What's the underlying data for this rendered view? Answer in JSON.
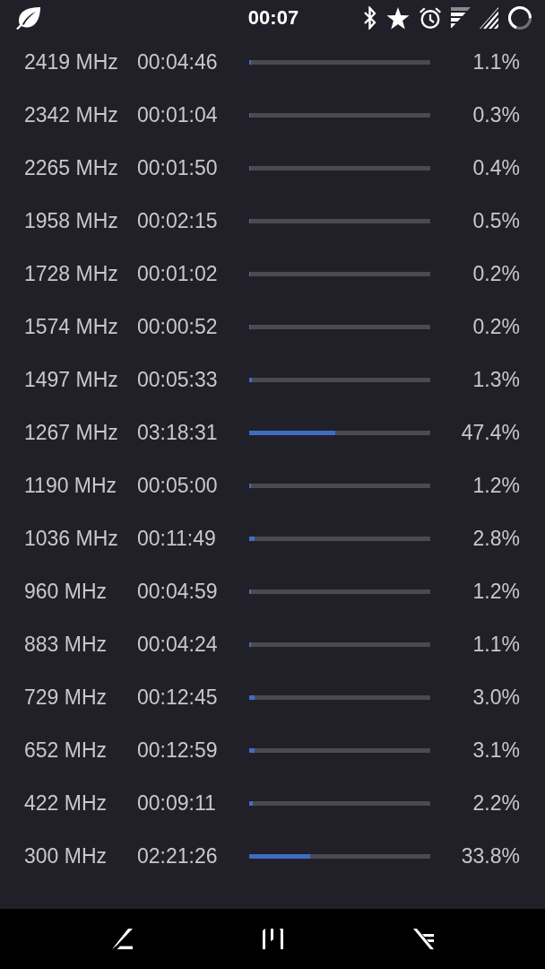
{
  "status_bar": {
    "time": "00:07"
  },
  "rows": [
    {
      "frequency": "2419 MHz",
      "time": "00:04:46",
      "level": 0.011,
      "percent": "1.1%"
    },
    {
      "frequency": "2342 MHz",
      "time": "00:01:04",
      "level": 0.003,
      "percent": "0.3%"
    },
    {
      "frequency": "2265 MHz",
      "time": "00:01:50",
      "level": 0.004,
      "percent": "0.4%"
    },
    {
      "frequency": "1958 MHz",
      "time": "00:02:15",
      "level": 0.005,
      "percent": "0.5%"
    },
    {
      "frequency": "1728 MHz",
      "time": "00:01:02",
      "level": 0.002,
      "percent": "0.2%"
    },
    {
      "frequency": "1574 MHz",
      "time": "00:00:52",
      "level": 0.002,
      "percent": "0.2%"
    },
    {
      "frequency": "1497 MHz",
      "time": "00:05:33",
      "level": 0.013,
      "percent": "1.3%"
    },
    {
      "frequency": "1267 MHz",
      "time": "03:18:31",
      "level": 0.474,
      "percent": "47.4%"
    },
    {
      "frequency": "1190 MHz",
      "time": "00:05:00",
      "level": 0.012,
      "percent": "1.2%"
    },
    {
      "frequency": "1036 MHz",
      "time": "00:11:49",
      "level": 0.028,
      "percent": "2.8%"
    },
    {
      "frequency": "960 MHz",
      "time": "00:04:59",
      "level": 0.012,
      "percent": "1.2%"
    },
    {
      "frequency": "883 MHz",
      "time": "00:04:24",
      "level": 0.011,
      "percent": "1.1%"
    },
    {
      "frequency": "729 MHz",
      "time": "00:12:45",
      "level": 0.03,
      "percent": "3.0%"
    },
    {
      "frequency": "652 MHz",
      "time": "00:12:59",
      "level": 0.031,
      "percent": "3.1%"
    },
    {
      "frequency": "422 MHz",
      "time": "00:09:11",
      "level": 0.022,
      "percent": "2.2%"
    },
    {
      "frequency": "300 MHz",
      "time": "02:21:26",
      "level": 0.338,
      "percent": "33.8%"
    }
  ]
}
